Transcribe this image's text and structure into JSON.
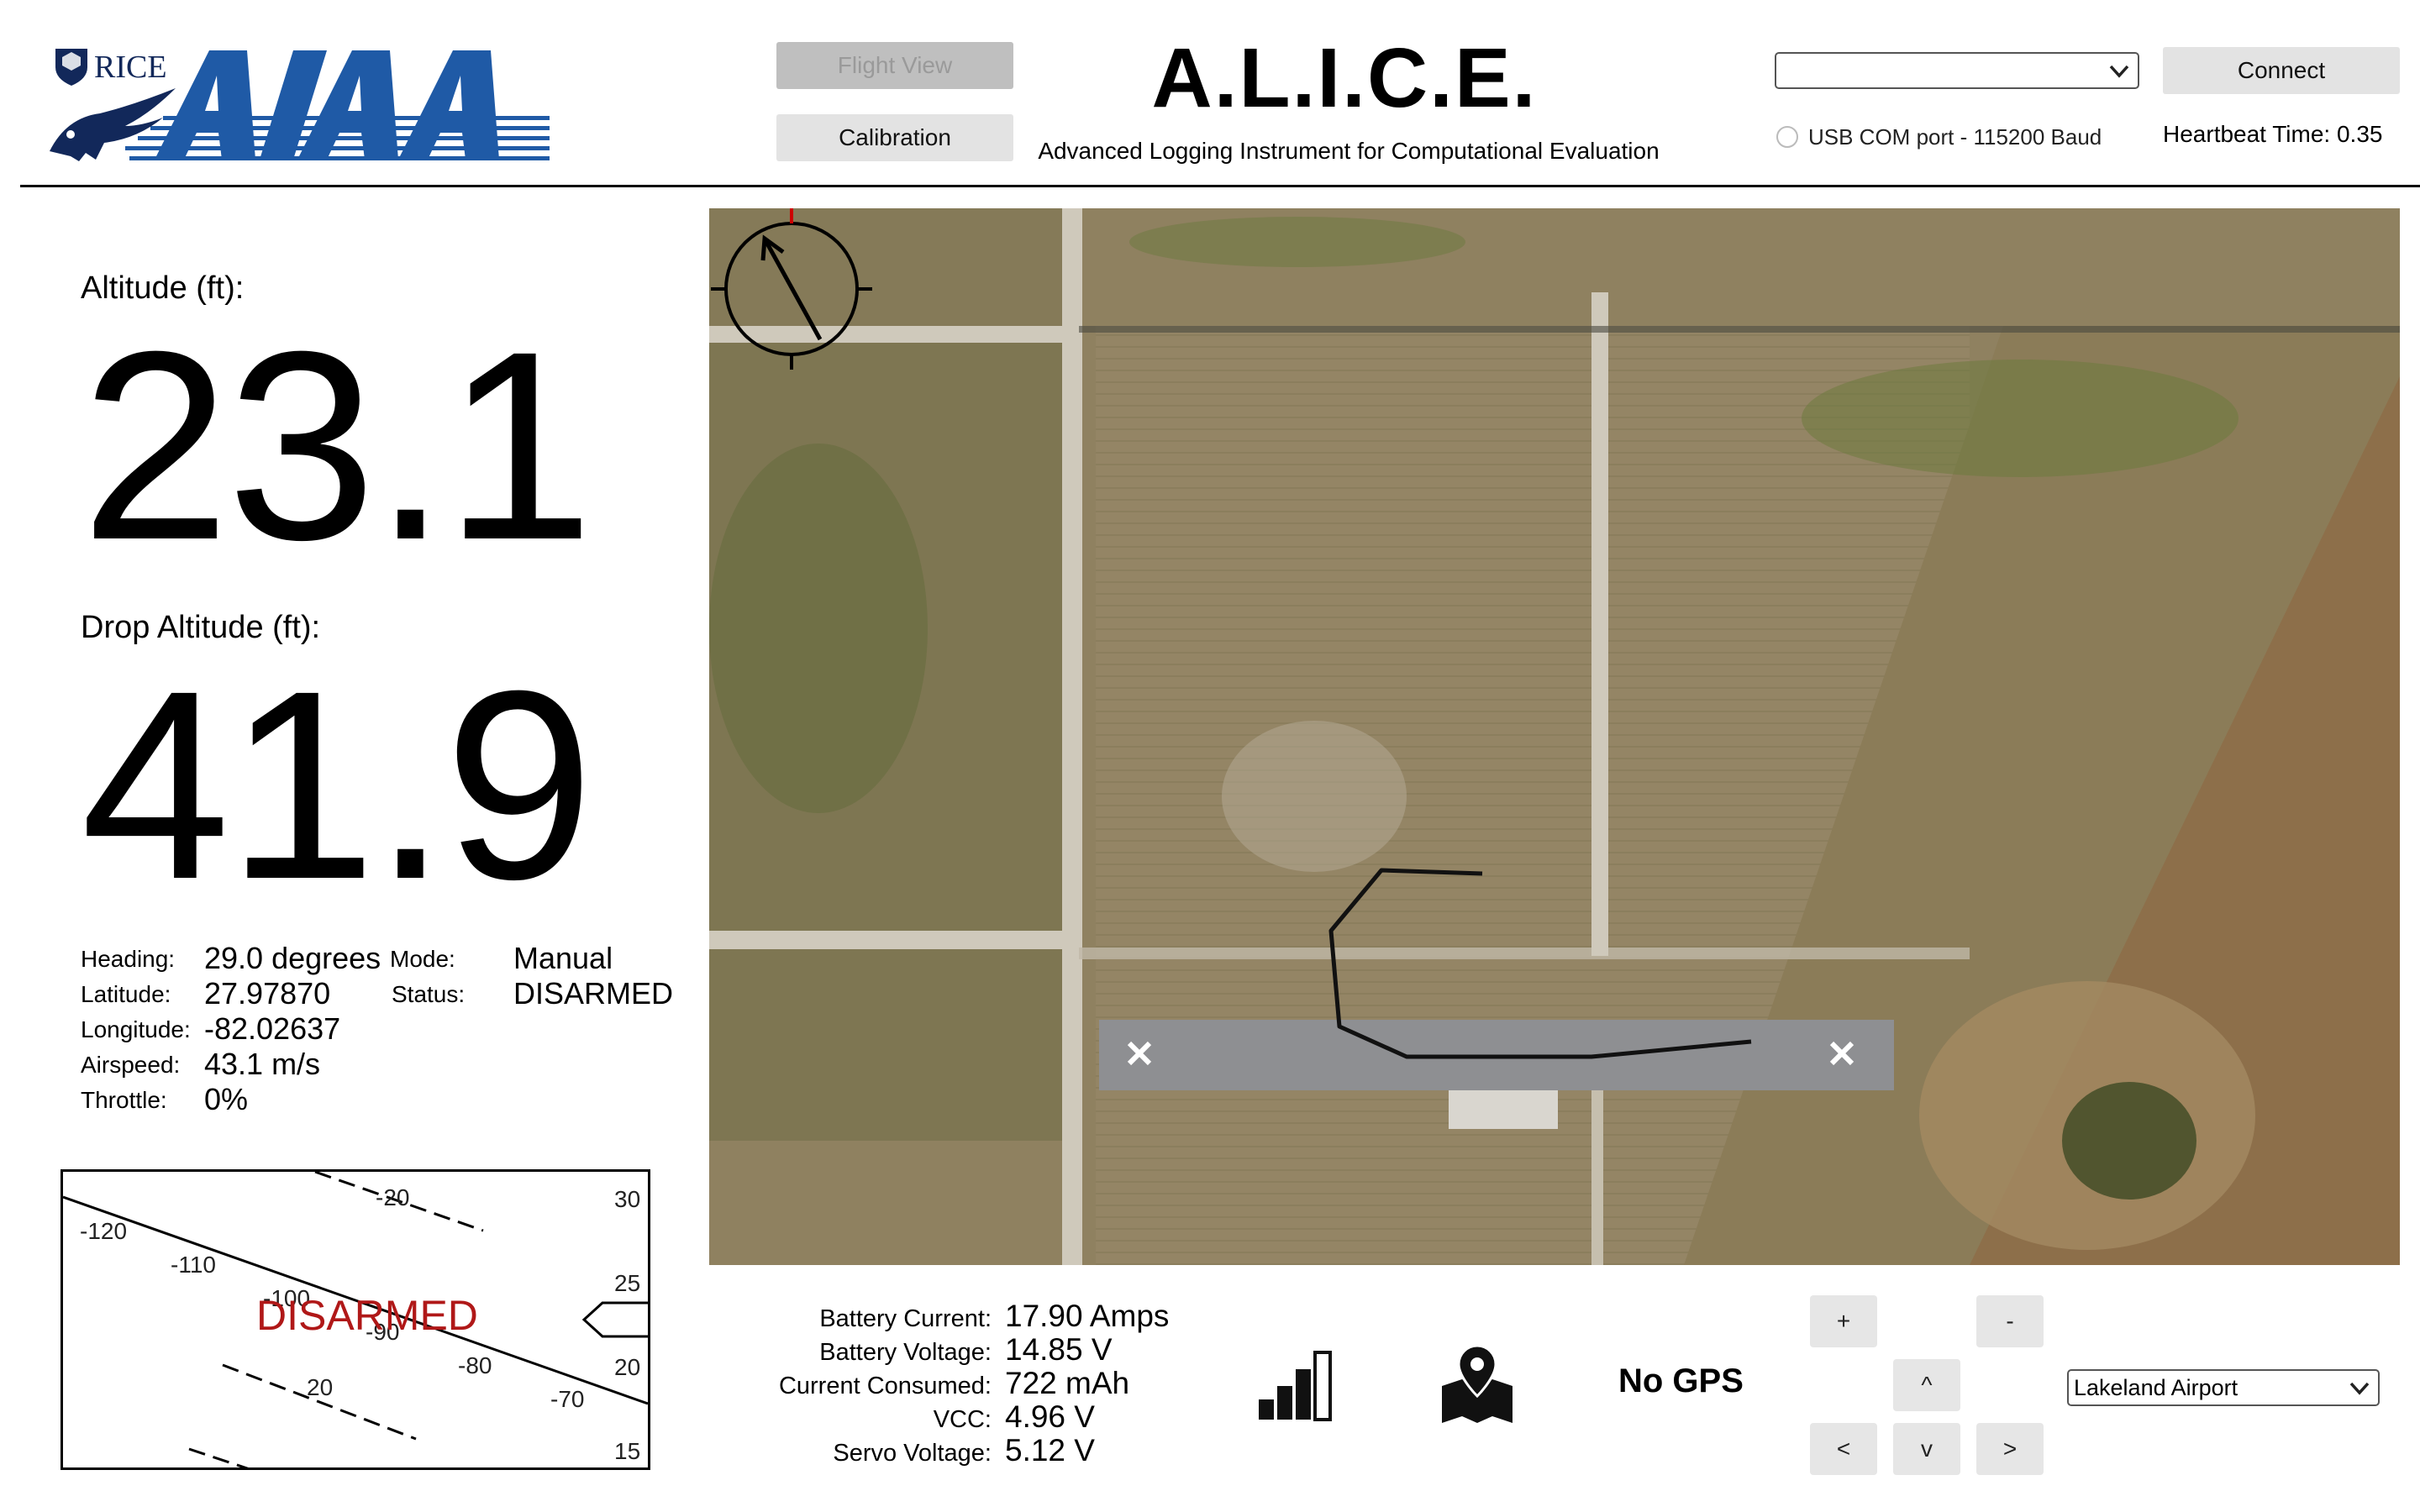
{
  "header": {
    "logo": {
      "university": "RICE",
      "org": "AIAA"
    },
    "flight_view_label": "Flight View",
    "calibration_label": "Calibration",
    "title": "A.L.I.C.E.",
    "subtitle": "Advanced Logging Instrument for Computational Evaluation",
    "port_select_value": "",
    "usb_label": "USB COM port - 115200 Baud",
    "usb_checked": false,
    "connect_label": "Connect",
    "heartbeat_label": "Heartbeat Time: 0.35"
  },
  "telemetry": {
    "altitude_label": "Altitude (ft):",
    "altitude_value": "23.1",
    "drop_altitude_label": "Drop Altitude (ft):",
    "drop_altitude_value": "41.9",
    "heading_label": "Heading:",
    "heading_value": "29.0 degrees",
    "latitude_label": "Latitude:",
    "latitude_value": "27.97870",
    "longitude_label": "Longitude:",
    "longitude_value": "-82.02637",
    "airspeed_label": "Airspeed:",
    "airspeed_value": "43.1 m/s",
    "throttle_label": "Throttle:",
    "throttle_value": "0%",
    "mode_label": "Mode:",
    "mode_value": "Manual",
    "status_label": "Status:",
    "status_value": "DISARMED"
  },
  "attitude": {
    "overlay_text": "DISARMED",
    "heading_ticks": [
      "-20",
      "-120",
      "-110",
      "-100",
      "-90",
      "-80",
      "-70",
      "20"
    ],
    "altitude_scale": [
      "30",
      "25",
      "20",
      "15"
    ]
  },
  "battery": {
    "current_label": "Battery Current:",
    "current_value": "17.90 Amps",
    "voltage_label": "Battery Voltage:",
    "voltage_value": "14.85 V",
    "consumed_label": "Current Consumed:",
    "consumed_value": "722 mAh",
    "vcc_label": "VCC:",
    "vcc_value": "4.96 V",
    "servo_label": "Servo Voltage:",
    "servo_value": "5.12 V"
  },
  "status_icons": {
    "signal_icon": "signal-bars-icon",
    "map_icon": "map-pin-icon",
    "gps_text": "No GPS"
  },
  "map_controls": {
    "zoom_in": "+",
    "zoom_out": "-",
    "up": "^",
    "left": "<",
    "down": "v",
    "right": ">",
    "location_value": "Lakeland Airport"
  },
  "colors": {
    "logo_blue": "#1f5aa6",
    "logo_navy": "#12285a",
    "disarmed_red": "#b01818",
    "button_gray": "#e3e3e3",
    "flight_path": "#111111"
  }
}
